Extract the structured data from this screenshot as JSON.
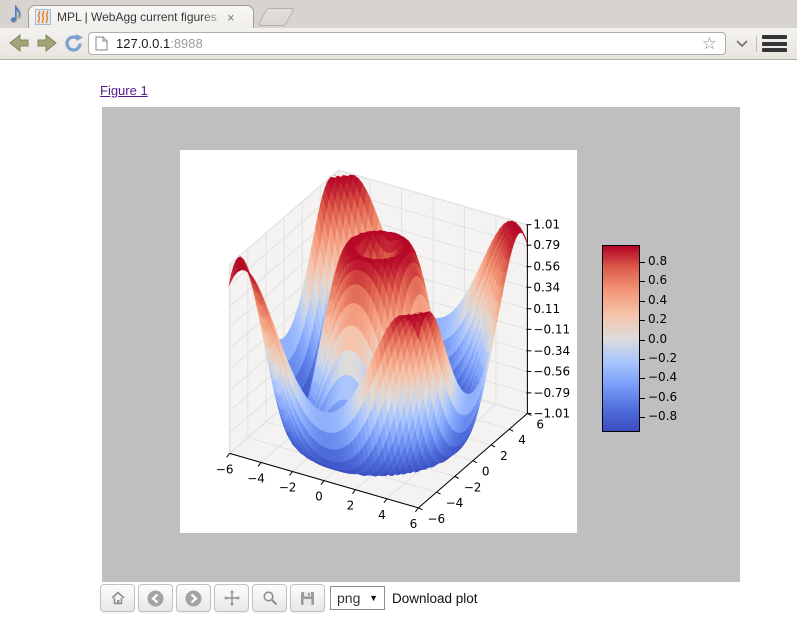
{
  "browser": {
    "tab_title": "MPL | WebAgg current figures",
    "close_label": "×",
    "url_host": "127.0.0.1",
    "url_port": ":8988"
  },
  "page": {
    "figure_link": "Figure 1"
  },
  "mpl": {
    "format": "png",
    "download_label": "Download plot",
    "buttons": [
      "home",
      "back",
      "forward",
      "pan",
      "zoom",
      "save"
    ]
  },
  "chart_data": {
    "type": "surface3d",
    "function": "z = sin(sqrt(x^2 + y^2))",
    "expression_js": "Math.sin(Math.sqrt(x*x+y*y))",
    "x_range": [
      -6,
      6
    ],
    "y_range": [
      -6,
      6
    ],
    "z_lim": [
      -1.01,
      1.01
    ],
    "grid_cells": 48,
    "view": {
      "azim": -60,
      "elev": 30
    },
    "colormap": "coolwarm",
    "colormap_anchors": [
      [
        59,
        76,
        192
      ],
      [
        81,
        112,
        221
      ],
      [
        124,
        159,
        249
      ],
      [
        169,
        197,
        254
      ],
      [
        221,
        220,
        219
      ],
      [
        245,
        196,
        171
      ],
      [
        244,
        154,
        123
      ],
      [
        222,
        96,
        77
      ],
      [
        180,
        4,
        38
      ]
    ],
    "x_tick_values": [
      -6,
      -4,
      -2,
      0,
      2,
      4,
      6
    ],
    "x_tick_labels": [
      "−6",
      "−4",
      "−2",
      "0",
      "2",
      "4",
      "6"
    ],
    "y_tick_values": [
      -6,
      -4,
      -2,
      0,
      2,
      4,
      6
    ],
    "y_tick_labels": [
      "−6",
      "−4",
      "−2",
      "0",
      "2",
      "4",
      "6"
    ],
    "z_tick_values": [
      1.01,
      0.79,
      0.56,
      0.34,
      0.11,
      -0.11,
      -0.34,
      -0.56,
      -0.79,
      -1.01
    ],
    "z_tick_labels": [
      "1.01",
      "0.79",
      "0.56",
      "0.34",
      "0.11",
      "−0.11",
      "−0.34",
      "−0.56",
      "−0.79",
      "−1.01"
    ],
    "colorbar_tick_labels": [
      "0.8",
      "0.6",
      "0.4",
      "0.2",
      "0.0",
      "−0.2",
      "−0.4",
      "−0.6",
      "−0.8"
    ],
    "pane_color": "#f4f3f1",
    "grid_color": "#e2e2e2",
    "background_color": "#bfbfbf"
  }
}
